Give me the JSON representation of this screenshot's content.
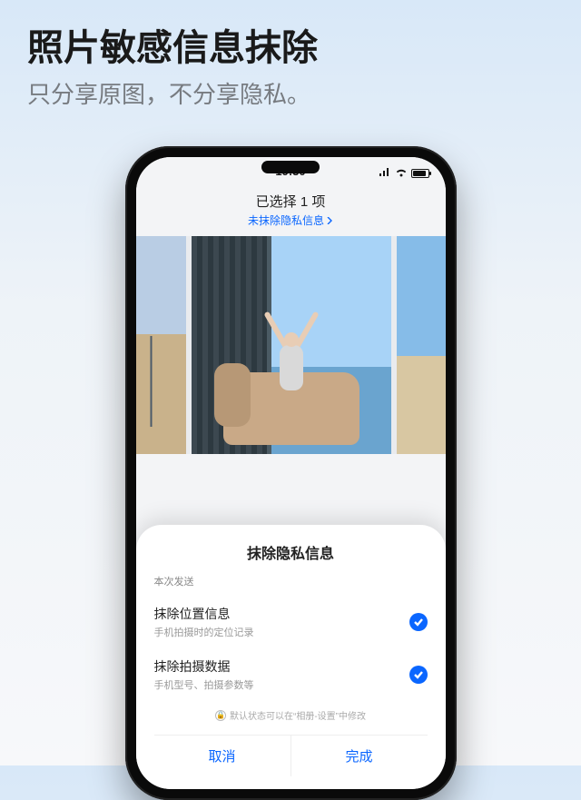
{
  "page": {
    "title": "照片敏感信息抹除",
    "subtitle": "只分享原图，不分享隐私。"
  },
  "status": {
    "time": "19:30"
  },
  "appbar": {
    "title": "已选择 1 项",
    "link": "未抹除隐私信息"
  },
  "sheet": {
    "title": "抹除隐私信息",
    "section": "本次发送",
    "rows": [
      {
        "title": "抹除位置信息",
        "desc": "手机拍摄时的定位记录"
      },
      {
        "title": "抹除拍摄数据",
        "desc": "手机型号、拍摄参数等"
      }
    ],
    "hint": "默认状态可以在“相册-设置”中修改",
    "cancel": "取消",
    "done": "完成"
  }
}
